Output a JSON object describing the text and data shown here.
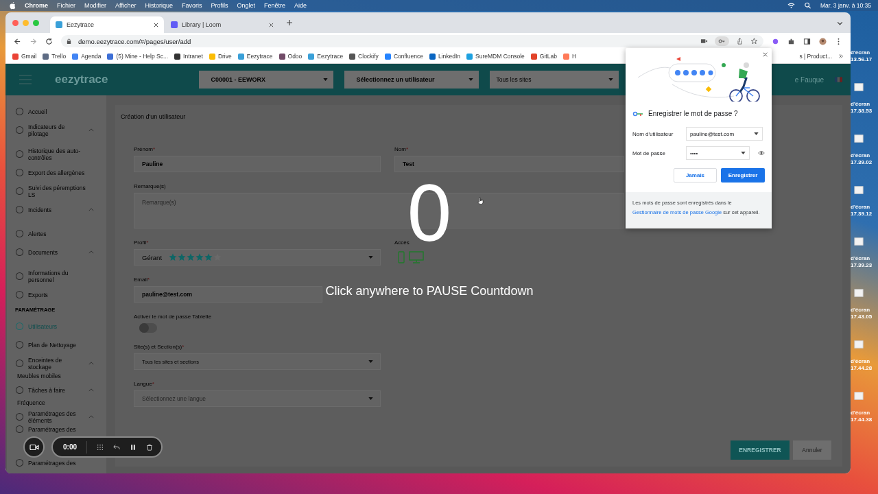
{
  "menubar": {
    "app": "Chrome",
    "menus": [
      "Fichier",
      "Modifier",
      "Afficher",
      "Historique",
      "Favoris",
      "Profils",
      "Onglet",
      "Fenêtre",
      "Aide"
    ],
    "clock": "Mar. 3 janv. à 10:35"
  },
  "browser": {
    "tabs": [
      {
        "title": "Eezytrace",
        "selected": true
      },
      {
        "title": "Library | Loom",
        "selected": false
      }
    ],
    "url": "demo.eezytrace.com/#/pages/user/add",
    "bookmarks": [
      {
        "label": "Gmail",
        "color": "#ea4335"
      },
      {
        "label": "Trello",
        "color": "#5e6c84"
      },
      {
        "label": "Agenda",
        "color": "#4285f4"
      },
      {
        "label": "(5) Mine - Help Sc...",
        "color": "#3d6fd6"
      },
      {
        "label": "Intranet",
        "color": "#333333"
      },
      {
        "label": "Drive",
        "color": "#fbbc04"
      },
      {
        "label": "Eezytrace",
        "color": "#3aa0d8"
      },
      {
        "label": "Odoo",
        "color": "#714b67"
      },
      {
        "label": "Eezytrace",
        "color": "#3aa0d8"
      },
      {
        "label": "Clockify",
        "color": "#555555"
      },
      {
        "label": "Confluence",
        "color": "#2684ff"
      },
      {
        "label": "LinkedIn",
        "color": "#0a66c2"
      },
      {
        "label": "SureMDM Console",
        "color": "#1ea1e0"
      },
      {
        "label": "GitLab",
        "color": "#e24329"
      },
      {
        "label": "H",
        "color": "#ff7a59"
      }
    ],
    "bookmarks_tail": "s | Product..."
  },
  "app": {
    "logo": "eezytrace",
    "selects": [
      "C00001 - EEWORX",
      "Sélectionnez un utilisateur",
      "Tous les sites"
    ],
    "user": "e Fauque",
    "sidebar": [
      {
        "kind": "item",
        "label": "Accueil",
        "selected": false
      },
      {
        "kind": "item",
        "label": "Indicateurs de pilotage",
        "selected": false,
        "expanded": true
      },
      {
        "kind": "item",
        "label": "Historique des auto-contrôles",
        "selected": false
      },
      {
        "kind": "item",
        "label": "Export des allergènes",
        "selected": false
      },
      {
        "kind": "item",
        "label": "Suivi des péremptions LS",
        "selected": false
      },
      {
        "kind": "item",
        "label": "Incidents",
        "selected": false,
        "expanded": true
      },
      {
        "kind": "item",
        "label": "Alertes",
        "selected": false
      },
      {
        "kind": "item",
        "label": "Documents",
        "selected": false,
        "expanded": true
      },
      {
        "kind": "item",
        "label": "Informations du personnel",
        "selected": false
      },
      {
        "kind": "item",
        "label": "Exports",
        "selected": false
      },
      {
        "kind": "section",
        "label": "PARAMÉTRAGE"
      },
      {
        "kind": "item",
        "label": "Utilisateurs",
        "selected": true
      },
      {
        "kind": "item",
        "label": "Plan de Nettoyage",
        "selected": false
      },
      {
        "kind": "item",
        "label": "Enceintes de stockage",
        "selected": false,
        "expanded": true,
        "children": [
          {
            "label": "Meubles mobiles",
            "selected": false
          }
        ]
      },
      {
        "kind": "item",
        "label": "Tâches à faire",
        "selected": false,
        "expanded": true,
        "children": [
          {
            "label": "Fréquence",
            "selected": false
          }
        ]
      },
      {
        "kind": "item",
        "label": "Paramétrages des éléments",
        "selected": false,
        "expanded": true
      },
      {
        "kind": "item",
        "label": "Paramétrages des",
        "selected": false
      },
      {
        "kind": "item",
        "label": "Paramétrages des",
        "selected": false
      }
    ],
    "form": {
      "title": "Création d'un utilisateur",
      "fields": [
        {
          "kind": "text",
          "label": "Prénom",
          "mark": "*",
          "value": "Pauline"
        },
        {
          "kind": "text",
          "label": "Nom",
          "mark": "*",
          "value": "Test"
        },
        {
          "kind": "textarea",
          "label": "Remarque(s)",
          "placeholder": "Remarque(s)"
        },
        {
          "kind": "profile",
          "label": "Profil",
          "mark": "*",
          "value": "Gérant",
          "stars": 5
        },
        {
          "kind": "access",
          "label": "Accès"
        },
        {
          "kind": "email",
          "label": "Email",
          "mark": "*",
          "value": "pauline@test.com"
        },
        {
          "kind": "toggle",
          "label": "Activer le mot de passe Tablette",
          "on": false
        },
        {
          "kind": "select",
          "label": "Site(s) et Section(s)",
          "mark": "*",
          "value": "Tous les sites et sections"
        },
        {
          "kind": "select",
          "label": "Langue",
          "mark": "*",
          "placeholder": "Sélectionnez une langue"
        }
      ],
      "buttons": [
        {
          "label": "ENREGISTRER",
          "kind": "primary"
        },
        {
          "label": "Annuler",
          "kind": "secondary"
        }
      ]
    }
  },
  "password_popup": {
    "title": "Enregistrer le mot de passe ?",
    "username_label": "Nom d'utilisateur",
    "username": "pauline@test.com",
    "password_label": "Mot de passe",
    "password": "••••",
    "buttons": [
      {
        "label": "Jamais",
        "kind": "secondary"
      },
      {
        "label": "Enregistrer",
        "kind": "primary"
      }
    ],
    "note_before": "Les mots de passe sont enregistrés dans le",
    "note_link": "Gestionnaire de mots de passe Google",
    "note_after": "sur cet appareil."
  },
  "countdown": {
    "number": "0",
    "hint": "Click anywhere to PAUSE Countdown"
  },
  "recorder": {
    "time": "0:00"
  },
  "desktop_files": [
    {
      "line1": "d'écran",
      "line2": "13.56.17"
    },
    {
      "line1": "d'écran",
      "line2": "17.38.53"
    },
    {
      "line1": "d'écran",
      "line2": "17.39.02"
    },
    {
      "line1": "d'écran",
      "line2": "17.39.12"
    },
    {
      "line1": "d'écran",
      "line2": "17.39.23"
    },
    {
      "line1": "d'écran",
      "line2": "17.43.05"
    },
    {
      "line1": "d'écran",
      "line2": "17.44.28"
    },
    {
      "line1": "d'écran",
      "line2": "17.44.38"
    }
  ]
}
